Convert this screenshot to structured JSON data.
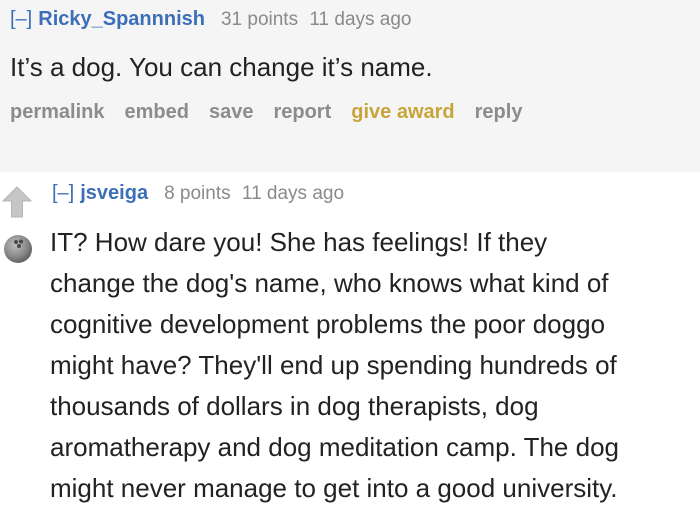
{
  "parent": {
    "collapse": "[–]",
    "author": "Ricky_Spannnish",
    "points": "31 points",
    "age": "11 days ago",
    "text": "It’s a dog. You can change it’s name.",
    "buttons": {
      "permalink": "permalink",
      "embed": "embed",
      "save": "save",
      "report": "report",
      "give_award": "give award",
      "reply": "reply"
    }
  },
  "child": {
    "collapse": "[–]",
    "author": "jsveiga",
    "points": "8 points",
    "age": "11 days ago",
    "lines": [
      "IT? How dare you! She has feelings! If they",
      "change the dog's name, who knows what kind of",
      "cognitive development problems the poor doggo",
      "might have? They'll end up spending hundreds of",
      "thousands of dollars in dog therapists, dog",
      "aromatherapy and dog meditation camp. The dog",
      "might never manage to get into a good university."
    ]
  },
  "icons": {
    "upvote": "upvote-arrow-icon",
    "downvote": "downvote-ball-icon"
  },
  "colors": {
    "link": "#3c6fb8",
    "award": "#c8a53a",
    "muted": "#8c8c8c",
    "parent_bg": "#f5f5f6"
  }
}
